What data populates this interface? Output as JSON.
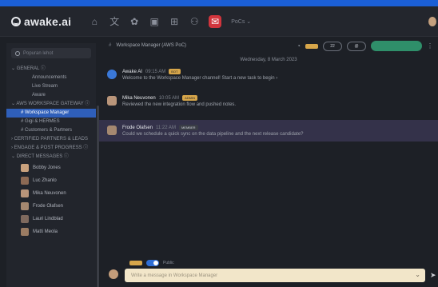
{
  "app": {
    "logo_text": "awake.ai",
    "workspace": "PoCs ⌄"
  },
  "topbar": {
    "icons": [
      "home-icon",
      "translate-icon",
      "sprout-icon",
      "calendar-icon",
      "grid-icon",
      "team-icon",
      "chat-icon"
    ]
  },
  "sidebar": {
    "search_placeholder": "Popuran lehot",
    "general_label": "⌄ GENERAL ⓘ",
    "general_items": [
      "Announcements",
      "Live Stream",
      "Aware"
    ],
    "workspace_label": "⌄ AWS WORKSPACE GATEWAY ⓘ",
    "channels": [
      "# Workspace Manager",
      "# Gigi & HERMES",
      "# Customers & Partners"
    ],
    "sec_extra_1": "› CERTIFIED PARTNERS & LEADS",
    "sec_extra_2": "› ENGAGE & POST PROGRESS ⓘ",
    "dm_label": "⌄ DIRECT MESSAGES ⓘ",
    "dms": [
      "Bobby Jones",
      "Luc Zhanlo",
      "Mika Neuvonen",
      "Frode Olafsen",
      "Lauri Lindblad",
      "Matti Meola"
    ]
  },
  "channel": {
    "header_name": "Workspace Manager (AWS PoC)",
    "header_count": "22",
    "date_divider": "Wednesday, 8 March 2023",
    "messages": [
      {
        "author": "Awake AI",
        "time": "09:15 AM",
        "badge": "BOT",
        "text": "Welcome to the Workspace Manager channel! Start a new task to begin ›"
      },
      {
        "author": "Mika Neuvonen",
        "time": "10:05 AM",
        "badge": "ADMIN",
        "text": "Reviewed the new integration flow and pushed notes."
      },
      {
        "author": "Frode Olafsen",
        "time": "11:22 AM",
        "badge": "MEMBER",
        "text": "Could we schedule a quick sync on the data pipeline and the next release candidate?"
      }
    ]
  },
  "composer": {
    "toggle_label": "Public",
    "placeholder": "Write a message in Workspace Manager"
  },
  "colors": {
    "accent": "#2f5fba",
    "alert": "#d2353d",
    "join": "#2f8f6a",
    "highlight": "#34324a"
  }
}
